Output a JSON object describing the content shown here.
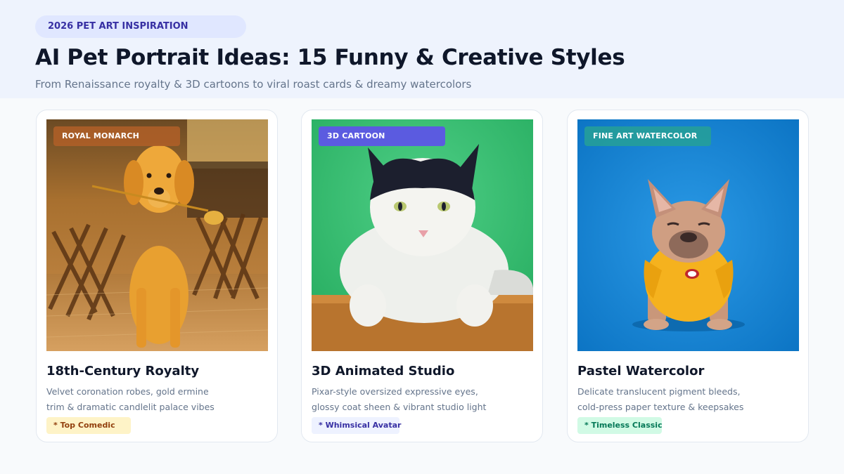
{
  "header": {
    "eyebrow": "2026 PET ART INSPIRATION",
    "title": "AI Pet Portrait Ideas: 15 Funny & Creative Styles",
    "subtitle": "From Renaissance royalty & 3D cartoons to viral roast cards & dreamy watercolors"
  },
  "cards": [
    {
      "tag": "ROYAL MONARCH",
      "title": "18th-Century Royalty",
      "desc_line1": "Velvet coronation robes, gold ermine",
      "desc_line2": "trim & dramatic candlelit palace vibes",
      "badge": "* Top Comedic",
      "image": "golden-retriever-with-rose-photo"
    },
    {
      "tag": "3D CARTOON",
      "title": "3D Animated Studio",
      "desc_line1": "Pixar-style oversized expressive eyes,",
      "desc_line2": "glossy coat sheen & vibrant studio light",
      "badge": "* Whimsical Avatar",
      "image": "black-white-cat-on-green-photo"
    },
    {
      "tag": "FINE ART WATERCOLOR",
      "title": "Pastel Watercolor",
      "desc_line1": "Delicate translucent pigment bleeds,",
      "desc_line2": "cold-press paper texture & keepsakes",
      "badge": "* Timeless Classic",
      "image": "french-bulldog-in-yellow-shirt-photo"
    }
  ],
  "colors": {
    "hero_bg": "#eef3fd",
    "page_bg": "#f8fafc",
    "accent_indigo": "#5b5be0",
    "royal_tag": "#b05f28",
    "watercolor_tag": "#26a096"
  }
}
